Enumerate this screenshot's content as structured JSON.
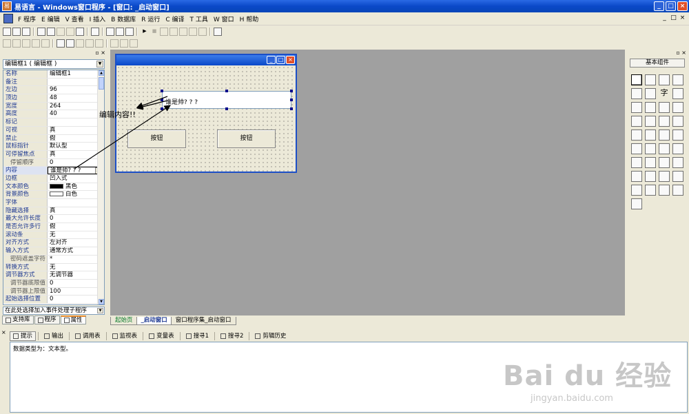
{
  "app": {
    "title": "易语言 - Windows窗口程序 - [窗口: _启动窗口]",
    "icon_label": "易"
  },
  "window_buttons": [
    "_",
    "□",
    "×"
  ],
  "menu": [
    "F 程序",
    "E 编辑",
    "V 查看",
    "I 插入",
    "B 数据库",
    "R 运行",
    "C 编译",
    "T 工具",
    "W 窗口",
    "H 帮助"
  ],
  "mdi_buttons": [
    "_",
    "□",
    "×"
  ],
  "toolbar1": [
    "new",
    "open",
    "save",
    "cut",
    "copy",
    "paste",
    "undo",
    "redo",
    "find",
    "run",
    "stop",
    "step-into",
    "step-over",
    "step-out",
    "pause",
    "breakpoint"
  ],
  "toolbar2": [
    "align-left",
    "align-center",
    "align-right",
    "align-top",
    "align-middle",
    "align-bottom",
    "same-width",
    "same-height"
  ],
  "properties": {
    "object": "编辑框1 ( 编辑框 )",
    "rows": [
      {
        "name": "名称",
        "value": "编辑框1"
      },
      {
        "name": "备注",
        "value": ""
      },
      {
        "name": "左边",
        "value": "96"
      },
      {
        "name": "顶边",
        "value": "48"
      },
      {
        "name": "宽度",
        "value": "264"
      },
      {
        "name": "高度",
        "value": "40"
      },
      {
        "name": "标记",
        "value": ""
      },
      {
        "name": "可视",
        "value": "真"
      },
      {
        "name": "禁止",
        "value": "假"
      },
      {
        "name": "鼠标指针",
        "value": "默认型"
      },
      {
        "name": "可停留焦点",
        "value": "真"
      },
      {
        "name": "停留顺序",
        "value": "0",
        "sub": true
      },
      {
        "name": "内容",
        "value": "谁是帅? ? ?",
        "selected": true
      },
      {
        "name": "边框",
        "value": "凹入式"
      },
      {
        "name": "文本颜色",
        "value": "黑色",
        "swatch": "#000000"
      },
      {
        "name": "背景颜色",
        "value": "白色",
        "swatch": "#ffffff"
      },
      {
        "name": "字体",
        "value": ""
      },
      {
        "name": "隐藏选择",
        "value": "真"
      },
      {
        "name": "最大允许长度",
        "value": "0"
      },
      {
        "name": "是否允许多行",
        "value": "假"
      },
      {
        "name": "滚动条",
        "value": "无"
      },
      {
        "name": "对齐方式",
        "value": "左对齐"
      },
      {
        "name": "输入方式",
        "value": "通常方式"
      },
      {
        "name": "密码遮盖字符",
        "value": "*",
        "sub": true
      },
      {
        "name": "转换方式",
        "value": "无"
      },
      {
        "name": "调节器方式",
        "value": "无调节器"
      },
      {
        "name": "调节器底限值",
        "value": "0",
        "sub": true
      },
      {
        "name": "调节器上限值",
        "value": "100",
        "sub": true
      },
      {
        "name": "起始选择位置",
        "value": "0"
      }
    ],
    "event_placeholder": "在此处选择加入事件处理子程序",
    "edit_button": "...",
    "scroll_up": "▲",
    "scroll_down": "▼"
  },
  "left_tabs": [
    "支持库",
    "程序",
    "属性"
  ],
  "form": {
    "edit_text": "谁是帅? ? ?",
    "button1": "按钮",
    "button2": "按钮"
  },
  "annotation": "编辑内容!!",
  "doc_tabs": [
    "起始页",
    "_启动窗口",
    "窗口程序集_启动窗口"
  ],
  "components_title": "基本组件",
  "components": [
    "pointer",
    "label",
    "image",
    "shape",
    "edit",
    "picturebox",
    "字",
    "frame",
    "checkbox",
    "radiobox",
    "combo",
    "listbox",
    "list",
    "scroll-h",
    "scroll-v",
    "progress",
    "track",
    "tab",
    "datetime",
    "month",
    "drive",
    "dir",
    "file",
    "color",
    "timer",
    "printer",
    "link",
    "data",
    "table",
    "tree",
    "status",
    "chart",
    "db",
    "odbc",
    "odbc2",
    "db2",
    "odbc3"
  ],
  "output_tabs": [
    "提示",
    "输出",
    "调用表",
    "监视表",
    "变量表",
    "搜寻1",
    "搜寻2",
    "剪辑历史"
  ],
  "output_text": "数据类型为：文本型。",
  "watermark": {
    "main": "Bai du 经验",
    "sub": "jingyan.baidu.com"
  }
}
